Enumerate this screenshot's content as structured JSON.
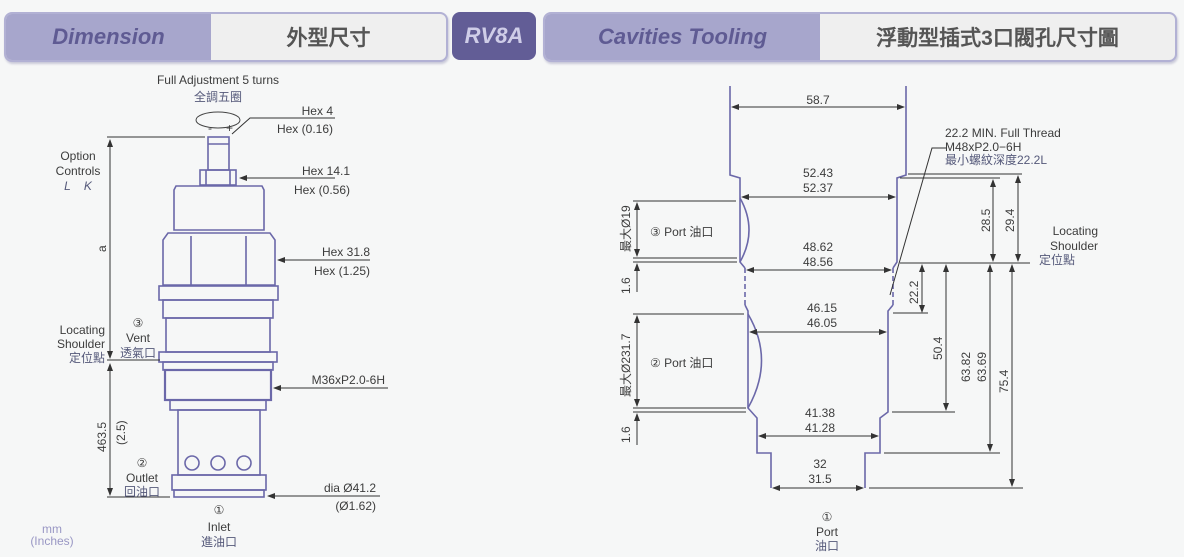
{
  "header": {
    "dimension_en": "Dimension",
    "dimension_zh": "外型尺寸",
    "model": "RV8A",
    "cavity_en": "Cavities Tooling",
    "cavity_zh": "浮動型插式3口閥孔尺寸圖"
  },
  "left_drawing": {
    "adjust_en": "Full Adjustment 5 turns",
    "adjust_zh": "全調五圈",
    "minus": "-",
    "plus": "+",
    "hex4": "Hex 4",
    "hex4_in": "Hex (0.16)",
    "hex14": "Hex 14.1",
    "hex14_in": "Hex (0.56)",
    "hex31": "Hex 31.8",
    "hex31_in": "Hex (1.25)",
    "option1": "Option",
    "option2": "Controls",
    "option_codes": "L    K",
    "dim_a": "a",
    "port3_num": "③",
    "port3_en": "Vent",
    "port3_zh": "透氣口",
    "shoulder1": "Locating",
    "shoulder2": "Shoulder",
    "shoulder_zh": "定位點",
    "thread": "M36xP2.0-6H",
    "dim_mm": "463.5",
    "dim_in": "(2.5)",
    "port2_num": "②",
    "port2_en": "Outlet",
    "port2_zh": "回油口",
    "dia": "dia  Ø41.2",
    "dia_in": "(Ø1.62)",
    "port1_num": "①",
    "port1_en": "Inlet",
    "port1_zh": "進油口",
    "units_mm": "mm",
    "units_in": "(Inches)"
  },
  "right_drawing": {
    "d58": "58.7",
    "d52a": "52.43",
    "d52b": "52.37",
    "d48a": "48.62",
    "d48b": "48.56",
    "d46a": "46.15",
    "d46b": "46.05",
    "d41a": "41.38",
    "d41b": "41.28",
    "d32a": "32",
    "d32b": "31.5",
    "thread1": "22.2 MIN. Full Thread",
    "thread2": "M48xP2.0−6H",
    "thread3": "最小螺紋深度22.2L",
    "h285": "28.5",
    "h294": "29.4",
    "h222": "22.2",
    "h504": "50.4",
    "h6382": "63.82",
    "h6369": "63.69",
    "h754": "75.4",
    "shoulder1": "Locating",
    "shoulder2": "Shoulder",
    "shoulder_zh": "定位點",
    "port3": "③ Port 油口",
    "port3_dia": "最大Ø19",
    "gap1": "1.6",
    "port2": "② Port 油口",
    "port2_dia": "最大Ø231.7",
    "gap2": "1.6",
    "port1_num": "①",
    "port1_en": "Port",
    "port1_zh": "油口"
  },
  "colors": {
    "header_bg": "#a7a6cc",
    "header_text": "#5f5b93",
    "badge_bg": "#625d96",
    "outline": "#6b68a9"
  }
}
